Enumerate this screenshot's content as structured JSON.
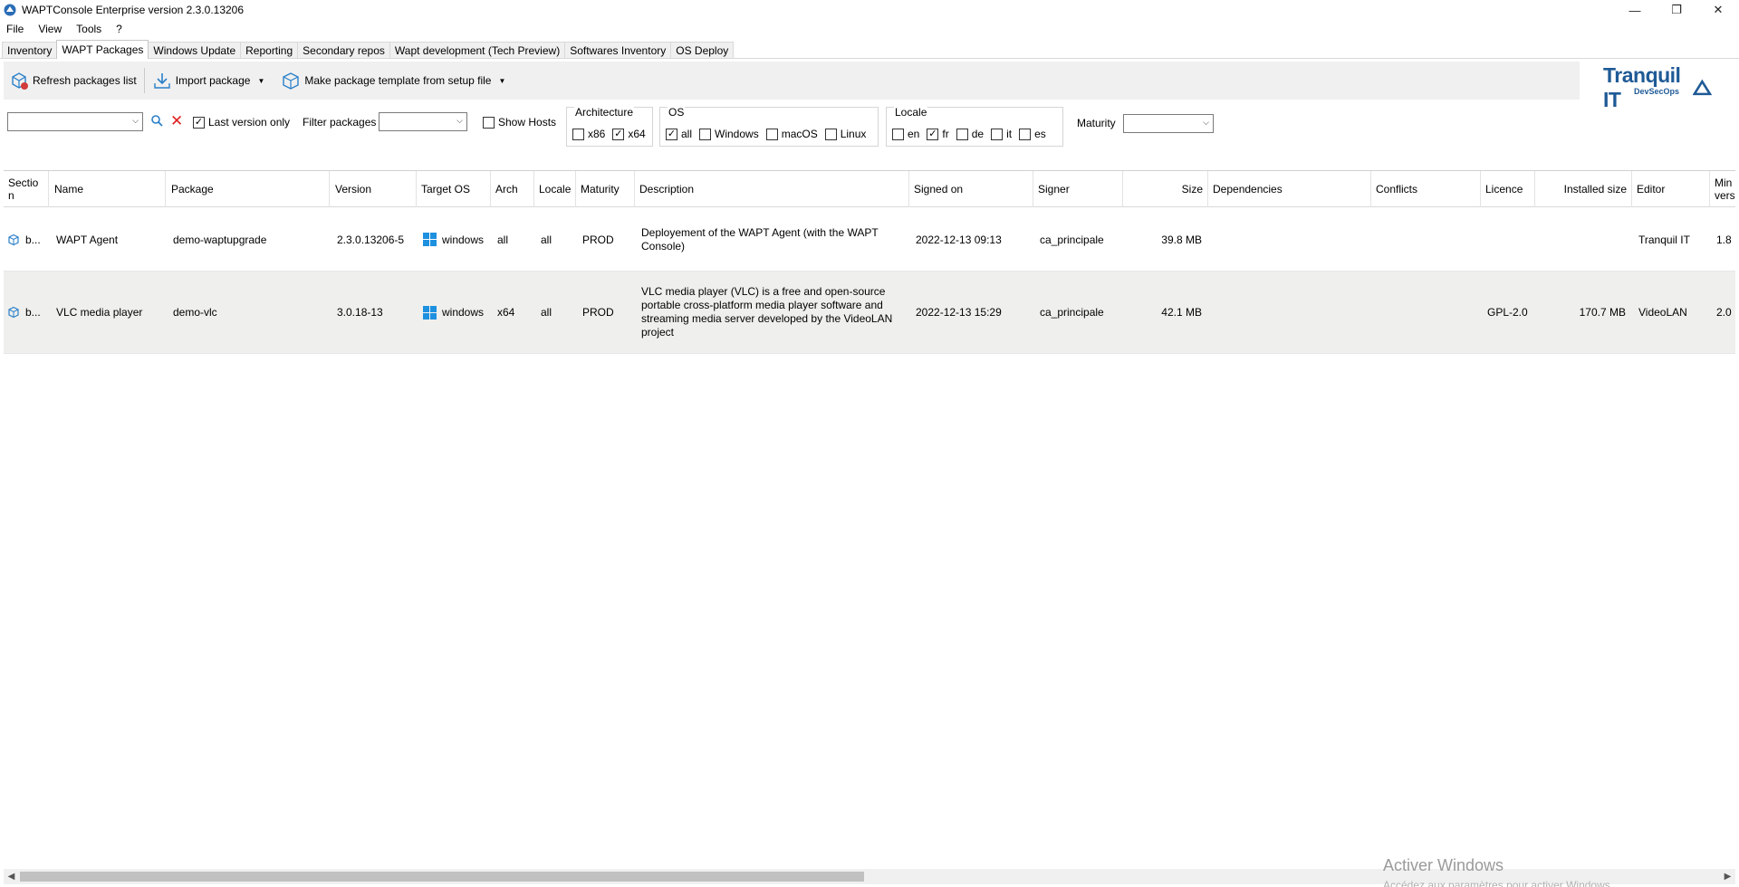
{
  "window": {
    "title": "WAPTConsole Enterprise version 2.3.0.13206",
    "controls": [
      "—",
      "❐",
      "✕"
    ]
  },
  "menu": [
    "File",
    "View",
    "Tools",
    "?"
  ],
  "tabs": [
    {
      "label": "Inventory",
      "active": false
    },
    {
      "label": "WAPT Packages",
      "active": true
    },
    {
      "label": "Windows Update",
      "active": false
    },
    {
      "label": "Reporting",
      "active": false
    },
    {
      "label": "Secondary repos",
      "active": false
    },
    {
      "label": "Wapt development (Tech Preview)",
      "active": false
    },
    {
      "label": "Softwares Inventory",
      "active": false
    },
    {
      "label": "OS Deploy",
      "active": false
    }
  ],
  "toolbar": {
    "refresh_label": "Refresh packages list",
    "import_label": "Import package",
    "template_label": "Make package template from setup file"
  },
  "logo": {
    "main": "Tranquil IT",
    "sub": "DevSecOps"
  },
  "filters": {
    "last_version_only": "Last version only",
    "filter_packages": "Filter packages",
    "show_hosts": "Show Hosts",
    "maturity": "Maturity",
    "architecture": {
      "title": "Architecture",
      "options": [
        {
          "label": "x86",
          "checked": false
        },
        {
          "label": "x64",
          "checked": true
        }
      ]
    },
    "os": {
      "title": "OS",
      "options": [
        {
          "label": "all",
          "checked": true
        },
        {
          "label": "Windows",
          "checked": false
        },
        {
          "label": "macOS",
          "checked": false
        },
        {
          "label": "Linux",
          "checked": false
        }
      ]
    },
    "locale": {
      "title": "Locale",
      "options": [
        {
          "label": "en",
          "checked": false
        },
        {
          "label": "fr",
          "checked": true
        },
        {
          "label": "de",
          "checked": false
        },
        {
          "label": "it",
          "checked": false
        },
        {
          "label": "es",
          "checked": false
        }
      ]
    }
  },
  "grid": {
    "columns": [
      "Sectio\nn",
      "Name",
      "Package",
      "Version",
      "Target OS",
      "Arch",
      "Locale",
      "Maturity",
      "Description",
      "Signed on",
      "Signer",
      "Size",
      "Dependencies",
      "Conflicts",
      "Licence",
      "Installed size",
      "Editor",
      "Min\nvers"
    ],
    "rows": [
      {
        "section": "b...",
        "name": "WAPT Agent",
        "package": "demo-waptupgrade",
        "version": "2.3.0.13206-5",
        "target_os": "windows",
        "arch": "all",
        "locale": "all",
        "maturity": "PROD",
        "description": "Deployement of the WAPT Agent (with the WAPT Console)",
        "signed_on": "2022-12-13 09:13",
        "signer": "ca_principale",
        "size": "39.8 MB",
        "dependencies": "",
        "conflicts": "",
        "licence": "",
        "installed_size": "",
        "editor": "Tranquil IT",
        "min_version": "1.8"
      },
      {
        "section": "b...",
        "name": "VLC media player",
        "package": "demo-vlc",
        "version": "3.0.18-13",
        "target_os": "windows",
        "arch": "x64",
        "locale": "all",
        "maturity": "PROD",
        "description": "VLC media player (VLC) is a free and open-source portable cross-platform media player software and streaming media server developed by the VideoLAN project",
        "signed_on": "2022-12-13 15:29",
        "signer": "ca_principale",
        "size": "42.1 MB",
        "dependencies": "",
        "conflicts": "",
        "licence": "GPL-2.0",
        "installed_size": "170.7 MB",
        "editor": "VideoLAN",
        "min_version": "2.0"
      }
    ]
  },
  "watermark": {
    "line1": "Activer Windows",
    "line2": "Accédez aux paramètres pour activer Windows."
  },
  "colors": {
    "accent": "#1f5a96",
    "windows_blue": "#1e90e0",
    "package_icon": "#2a7fc9"
  }
}
